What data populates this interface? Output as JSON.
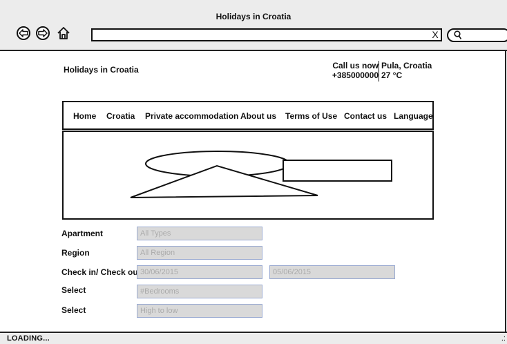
{
  "window": {
    "title": "Holidays in Croatia",
    "status": "LOADING...",
    "status_extra": ".:",
    "url_clear": "X"
  },
  "site": {
    "title": "Holidays in Croatia",
    "contact": {
      "call_label": "Call us now",
      "phone": "+385000000",
      "location": "Pula, Croatia",
      "temperature": "27 °C"
    },
    "nav": [
      "Home",
      "Croatia",
      "Private accommodation",
      "About us",
      "Terms of Use",
      "Contact us",
      "Language"
    ]
  },
  "form": {
    "apartment": {
      "label": "Apartment",
      "value": "All Types"
    },
    "region": {
      "label": "Region",
      "value": "All Region"
    },
    "checkin": {
      "label": "Check in/ Check out",
      "value": "30/06/2015",
      "checkout_value": "05/06/2015"
    },
    "bedrooms": {
      "label": "Select",
      "value": "#Bedrooms"
    },
    "sort": {
      "label": "Select",
      "value": "High to low"
    }
  }
}
